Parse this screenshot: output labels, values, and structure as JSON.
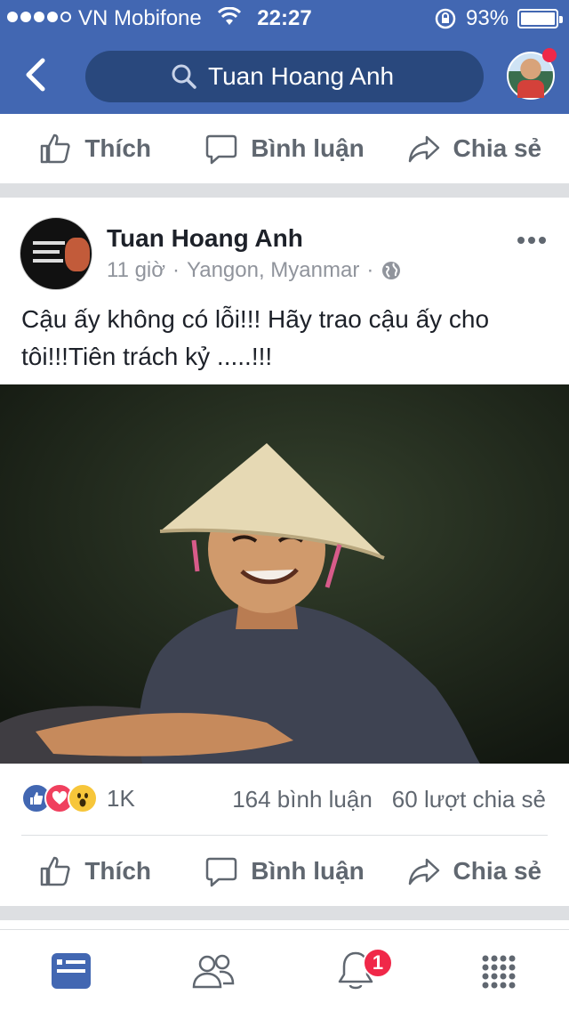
{
  "status_bar": {
    "carrier": "VN Mobifone",
    "time": "22:27",
    "battery": "93%"
  },
  "nav": {
    "search_text": "Tuan Hoang Anh"
  },
  "action_bar": {
    "like": "Thích",
    "comment": "Bình luận",
    "share": "Chia sẻ"
  },
  "post": {
    "author": "Tuan Hoang Anh",
    "time": "11 giờ",
    "location": "Yangon, Myanmar",
    "text": "Cậu ấy không có lỗi!!! Hãy trao cậu ấy cho tôi!!!Tiên trách kỷ .....!!!",
    "reaction_count": "1K",
    "comments": "164 bình luận",
    "shares": "60 lượt chia sẻ",
    "reactions": [
      "like",
      "love",
      "wow"
    ]
  },
  "tabbar": {
    "notifications_badge": "1"
  },
  "colors": {
    "brand": "#4267b2",
    "nav_search_bg": "#29487d",
    "badge": "#f02849"
  }
}
